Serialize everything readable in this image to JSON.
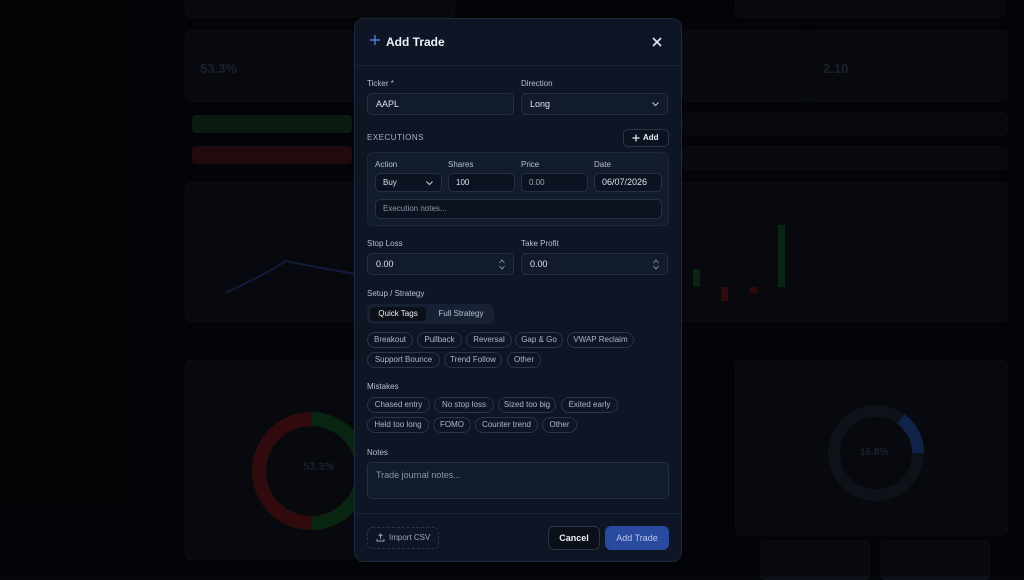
{
  "modal": {
    "title": "Add Trade",
    "close_icon": "close-icon",
    "ticker": {
      "label": "Ticker *",
      "value": "AAPL"
    },
    "direction": {
      "label": "Direction",
      "value": "Long"
    },
    "executions": {
      "section_label": "EXECUTIONS",
      "add_label": "Add",
      "columns": [
        "Action",
        "Shares",
        "Price",
        "Date"
      ],
      "row": {
        "action": "Buy",
        "shares": "100",
        "price": "0.00",
        "date": "06/07/2026"
      },
      "notes_placeholder": "Execution notes..."
    },
    "stop_loss": {
      "label": "Stop Loss",
      "value": "0.00"
    },
    "take_profit": {
      "label": "Take Profit",
      "value": "0.00"
    },
    "setup": {
      "label": "Setup / Strategy",
      "tabs": [
        "Quick Tags",
        "Full Strategy"
      ],
      "tags": [
        "Breakout",
        "Pullback",
        "Reversal",
        "Gap & Go",
        "VWAP Reclaim",
        "Support Bounce",
        "Trend Follow",
        "Other"
      ]
    },
    "mistakes": {
      "label": "Mistakes",
      "tags": [
        "Chased entry",
        "No stop loss",
        "Sized too big",
        "Exited early",
        "Held too long",
        "FOMO",
        "Counter trend",
        "Other"
      ]
    },
    "notes": {
      "label": "Notes",
      "placeholder": "Trade journal notes..."
    },
    "footer": {
      "import_label": "Import CSV",
      "cancel_label": "Cancel",
      "submit_label": "Add Trade"
    }
  },
  "background": {
    "pct_left": "53.3%",
    "value_right": "2.10",
    "donut_left": "53.3%",
    "donut_right": "16.8%"
  },
  "colors": {
    "accent": "#2a4aa0",
    "plus": "#4a7ee6",
    "gain": "#1f8a3a",
    "loss": "#b3232b"
  }
}
